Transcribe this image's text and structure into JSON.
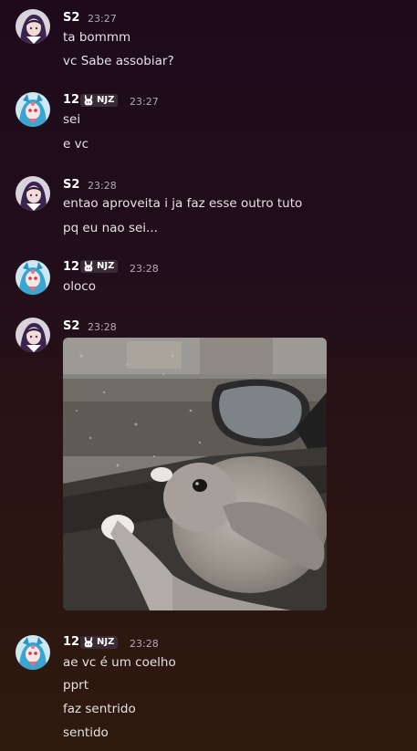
{
  "messages": [
    {
      "author": "S2",
      "time": "23:27",
      "lines": [
        "ta bommm",
        "vc Sabe assobiar?"
      ]
    },
    {
      "author": "12",
      "tag": "NJZ",
      "time": "23:27",
      "lines": [
        "sei",
        "e vc"
      ]
    },
    {
      "author": "S2",
      "time": "23:28",
      "lines": [
        "entao aproveita i ja faz esse outro tuto",
        "pq eu nao sei..."
      ]
    },
    {
      "author": "12",
      "tag": "NJZ",
      "time": "23:28",
      "lines": [
        "oloco"
      ]
    },
    {
      "author": "S2",
      "time": "23:28",
      "attachment": "gif of a rabbit by a car window"
    },
    {
      "author": "12",
      "tag": "NJZ",
      "time": "23:28",
      "lines": [
        "ae vc é um coelho",
        "pprt",
        "faz sentrido",
        "sentido"
      ]
    }
  ],
  "colors": {
    "accent": "#8e3fbd",
    "background": "#231015",
    "username": "#ffffff",
    "timestamp": "#b5a8b0"
  },
  "icons": {
    "tag_icon": "bunny-icon"
  }
}
